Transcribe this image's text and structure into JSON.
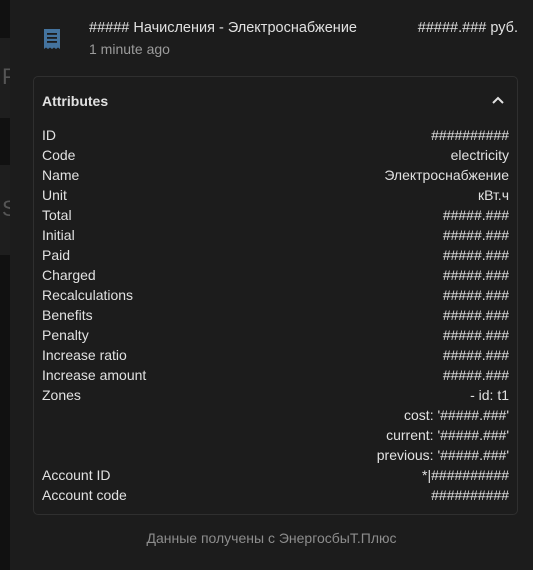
{
  "header": {
    "icon": "receipt-icon",
    "title": "##### Начисления - Электроснабжение",
    "last_changed": "1 minute ago",
    "state": "#####.### руб."
  },
  "attributes": {
    "title": "Attributes",
    "expanded": true,
    "items": [
      {
        "key": "ID",
        "value": "##########"
      },
      {
        "key": "Code",
        "value": "electricity"
      },
      {
        "key": "Name",
        "value": "Электроснабжение"
      },
      {
        "key": "Unit",
        "value": "кВт.ч"
      },
      {
        "key": "Total",
        "value": "#####.###"
      },
      {
        "key": "Initial",
        "value": "#####.###"
      },
      {
        "key": "Paid",
        "value": "#####.###"
      },
      {
        "key": "Charged",
        "value": "#####.###"
      },
      {
        "key": "Recalculations",
        "value": "#####.###"
      },
      {
        "key": "Benefits",
        "value": "#####.###"
      },
      {
        "key": "Penalty",
        "value": "#####.###"
      },
      {
        "key": "Increase ratio",
        "value": "#####.###"
      },
      {
        "key": "Increase amount",
        "value": "#####.###"
      },
      {
        "key": "Zones",
        "value": "- id: t1"
      },
      {
        "key": "",
        "value": "cost: '#####.###'"
      },
      {
        "key": "",
        "value": "current: '#####.###'"
      },
      {
        "key": "",
        "value": "previous: '#####.###'"
      },
      {
        "key": "Account ID",
        "value": "*|##########"
      },
      {
        "key": "Account code",
        "value": "##########"
      }
    ]
  },
  "footer": {
    "attribution": "Данные получены с ЭнергосбыТ.Плюс"
  },
  "background": {
    "letter_1": "Р",
    "letter_2": "S"
  }
}
